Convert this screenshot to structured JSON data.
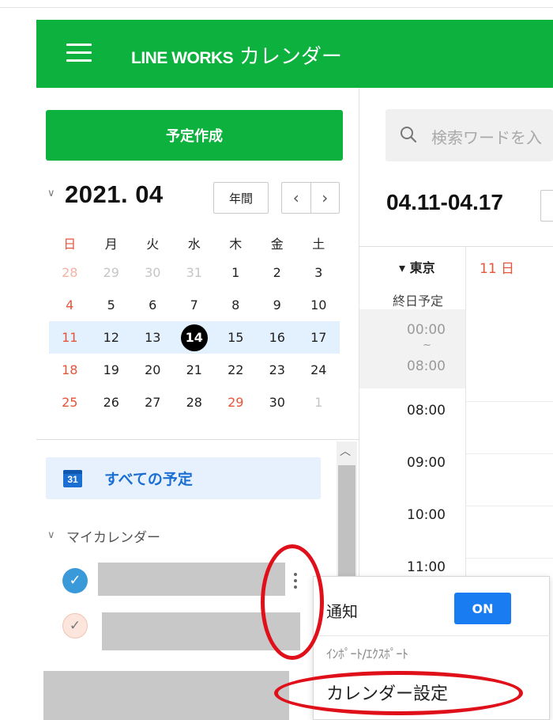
{
  "header": {
    "brand": "LINE WORKS",
    "app": "カレンダー"
  },
  "sidebar": {
    "create_button": "予定作成",
    "month_title": "2021. 04",
    "year_button": "年間",
    "prev_icon": "chevron-left",
    "next_icon": "chevron-right",
    "weekdays": [
      "日",
      "月",
      "火",
      "水",
      "木",
      "金",
      "土"
    ],
    "weeks": [
      [
        "28",
        "29",
        "30",
        "31",
        "1",
        "2",
        "3"
      ],
      [
        "4",
        "5",
        "6",
        "7",
        "8",
        "9",
        "10"
      ],
      [
        "11",
        "12",
        "13",
        "14",
        "15",
        "16",
        "17"
      ],
      [
        "18",
        "19",
        "20",
        "21",
        "22",
        "23",
        "24"
      ],
      [
        "25",
        "26",
        "27",
        "28",
        "29",
        "30",
        "1"
      ]
    ],
    "today": "14",
    "all_events_icon_text": "31",
    "all_events_label": "すべての予定",
    "my_calendars_label": "マイカレンダー"
  },
  "main": {
    "search_placeholder": "検索ワードを入",
    "week_range": "04.11-04.17",
    "timezone": "▾ 東京",
    "day_header": "11 日",
    "all_day_label": "終日予定",
    "collapsed_start": "00:00",
    "collapsed_tilde": "~",
    "collapsed_end": "08:00",
    "hours": [
      "08:00",
      "09:00",
      "10:00",
      "11:00"
    ]
  },
  "popup": {
    "notify_label": "通知",
    "on_label": "ON",
    "import_export_label": "ｲﾝﾎﾟｰﾄ/ｴｸｽﾎﾟｰﾄ",
    "settings_label": "カレンダー設定"
  },
  "colors": {
    "brand_green": "#0db13e",
    "accent_blue": "#1a7cf1",
    "sunday_red": "#e6543c",
    "annotation_red": "#e0101a"
  }
}
